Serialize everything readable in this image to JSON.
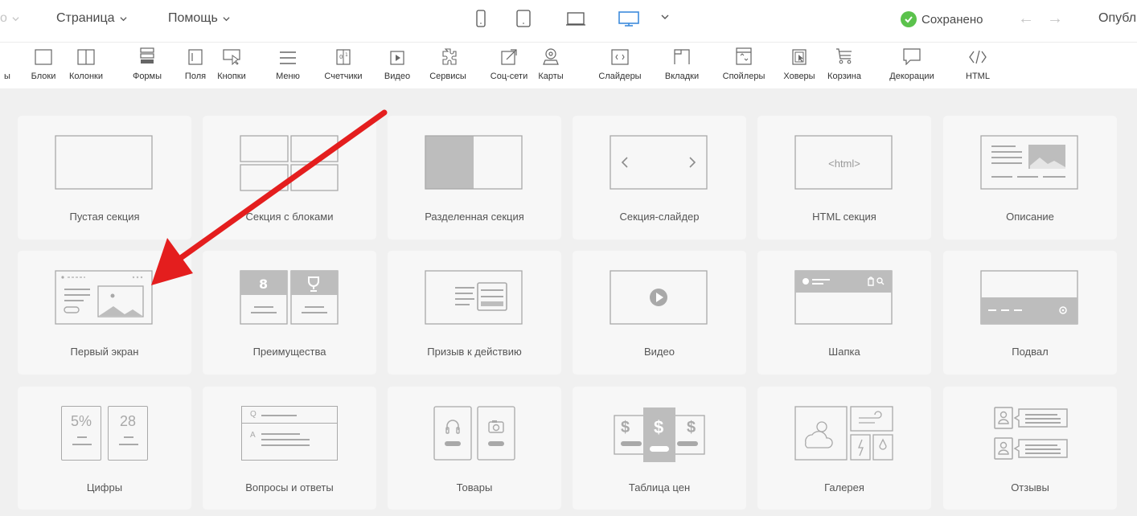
{
  "menu": {
    "first_item": "о",
    "page_label": "Страница",
    "help_label": "Помощь"
  },
  "devices": [
    "mobile-portrait-icon",
    "mobile-landscape-icon",
    "tablet-icon",
    "desktop-icon"
  ],
  "status": {
    "saved_label": "Сохранено",
    "publish_label": "Опубл"
  },
  "toolbar": {
    "items": [
      {
        "label": "ы",
        "icon": "partial-icon"
      },
      {
        "label": "Блоки",
        "icon": "block-icon"
      },
      {
        "label": "Колонки",
        "icon": "columns-icon"
      },
      {
        "label": "Формы",
        "icon": "forms-icon"
      },
      {
        "label": "Поля",
        "icon": "field-icon"
      },
      {
        "label": "Кнопки",
        "icon": "button-icon"
      },
      {
        "label": "Меню",
        "icon": "menu-icon"
      },
      {
        "label": "Счетчики",
        "icon": "counter-icon"
      },
      {
        "label": "Видео",
        "icon": "video-icon"
      },
      {
        "label": "Сервисы",
        "icon": "services-icon"
      },
      {
        "label": "Соц-сети",
        "icon": "social-icon"
      },
      {
        "label": "Карты",
        "icon": "map-icon"
      },
      {
        "label": "Слайдеры",
        "icon": "slider-icon"
      },
      {
        "label": "Вкладки",
        "icon": "tabs-icon"
      },
      {
        "label": "Спойлеры",
        "icon": "spoiler-icon"
      },
      {
        "label": "Ховеры",
        "icon": "hover-icon"
      },
      {
        "label": "Корзина",
        "icon": "cart-icon"
      },
      {
        "label": "Декорации",
        "icon": "decoration-icon"
      },
      {
        "label": "HTML",
        "icon": "html-icon"
      }
    ]
  },
  "sections": [
    {
      "label": "Пустая секция",
      "icon": "empty-section-icon"
    },
    {
      "label": "Секция с блоками",
      "icon": "blocks-section-icon"
    },
    {
      "label": "Разделенная секция",
      "icon": "split-section-icon"
    },
    {
      "label": "Секция-слайдер",
      "icon": "slider-section-icon"
    },
    {
      "label": "HTML секция",
      "icon": "html-section-icon",
      "thumb_text": "<html>"
    },
    {
      "label": "Описание",
      "icon": "description-icon"
    },
    {
      "label": "Первый экран",
      "icon": "hero-icon"
    },
    {
      "label": "Преимущества",
      "icon": "advantages-icon"
    },
    {
      "label": "Призыв к действию",
      "icon": "cta-icon"
    },
    {
      "label": "Видео",
      "icon": "video-section-icon"
    },
    {
      "label": "Шапка",
      "icon": "header-section-icon"
    },
    {
      "label": "Подвал",
      "icon": "footer-section-icon"
    },
    {
      "label": "Цифры",
      "icon": "numbers-icon",
      "thumb_a": "5%",
      "thumb_b": "28"
    },
    {
      "label": "Вопросы и ответы",
      "icon": "faq-icon",
      "thumb_q": "Q",
      "thumb_a": "A"
    },
    {
      "label": "Товары",
      "icon": "products-icon"
    },
    {
      "label": "Таблица цен",
      "icon": "pricing-icon",
      "thumb_symbol": "$"
    },
    {
      "label": "Галерея",
      "icon": "gallery-icon"
    },
    {
      "label": "Отзывы",
      "icon": "reviews-icon"
    }
  ],
  "colors": {
    "accent": "#3d8bdc",
    "saved": "#5bc24c",
    "annotation_arrow": "#e41e1e",
    "icon_stroke": "#9a9a9a",
    "icon_fill": "#bdbdbd"
  }
}
